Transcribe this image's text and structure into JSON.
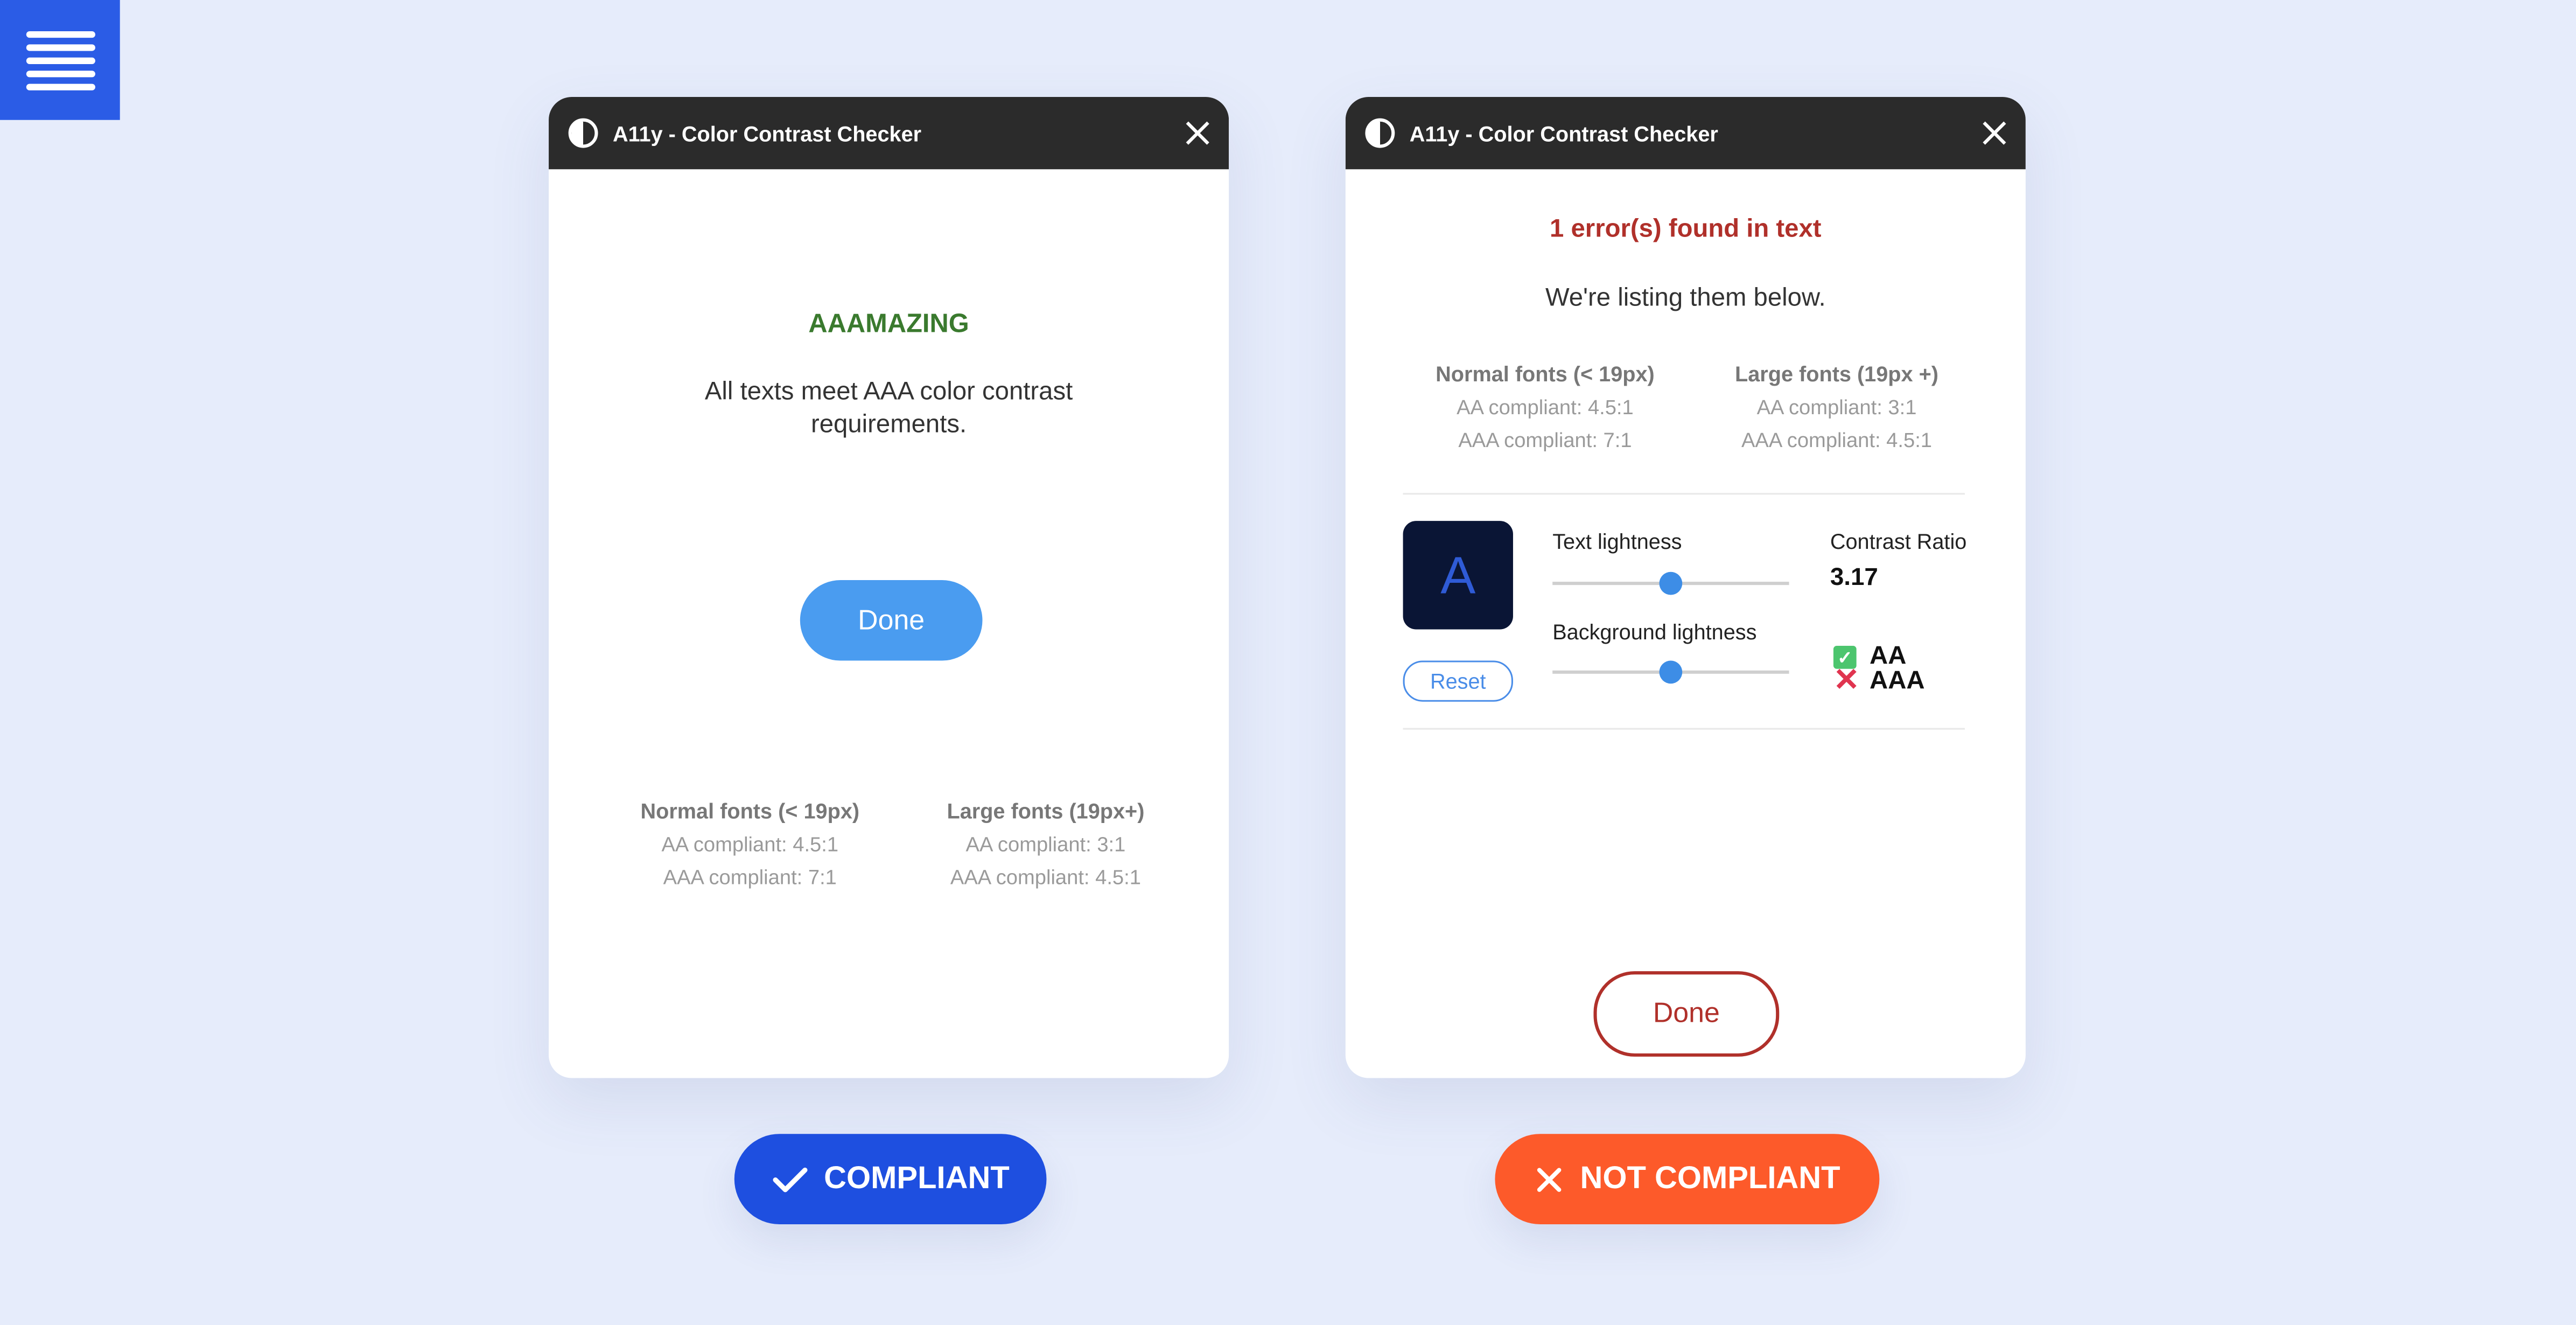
{
  "menu": {
    "icon": "hamburger-menu-icon"
  },
  "left_panel": {
    "title": "A11y - Color Contrast Checker",
    "heading": "AAAMAZING",
    "message": "All texts meet AAA color contrast requirements.",
    "done_label": "Done",
    "normal_fonts": {
      "title": "Normal fonts (< 19px)",
      "aa": "AA compliant: 4.5:1",
      "aaa": "AAA compliant: 7:1"
    },
    "large_fonts": {
      "title": "Large fonts (19px+)",
      "aa": "AA compliant: 3:1",
      "aaa": "AAA compliant: 4.5:1"
    }
  },
  "right_panel": {
    "title": "A11y - Color Contrast Checker",
    "error_title": "1 error(s) found in text",
    "error_subtitle": "We're listing them below.",
    "normal_fonts": {
      "title": "Normal fonts (< 19px)",
      "aa": "AA compliant: 4.5:1",
      "aaa": "AAA compliant: 7:1"
    },
    "large_fonts": {
      "title": "Large fonts (19px +)",
      "aa": "AA compliant: 3:1",
      "aaa": "AAA compliant: 4.5:1"
    },
    "preview_letter": "A",
    "preview_colors": {
      "background": "#0a1535",
      "text": "#2f5bd6"
    },
    "reset_label": "Reset",
    "text_lightness_label": "Text lightness",
    "text_lightness_value": 0.5,
    "background_lightness_label": "Background lightness",
    "background_lightness_value": 0.5,
    "contrast_ratio_label": "Contrast Ratio",
    "contrast_ratio_value": "3.17",
    "aa_label": "AA",
    "aa_passed": true,
    "aaa_label": "AAA",
    "aaa_passed": false,
    "done_label": "Done"
  },
  "badges": {
    "compliant_label": "COMPLIANT",
    "not_compliant_label": "NOT COMPLIANT"
  },
  "colors": {
    "page_background": "#e6ecfb",
    "accent_blue": "#1e4fe0",
    "accent_orange": "#fd5a2a",
    "success_green": "#3a7a2e",
    "error_red": "#b0302a",
    "titlebar": "#2b2b2b"
  }
}
